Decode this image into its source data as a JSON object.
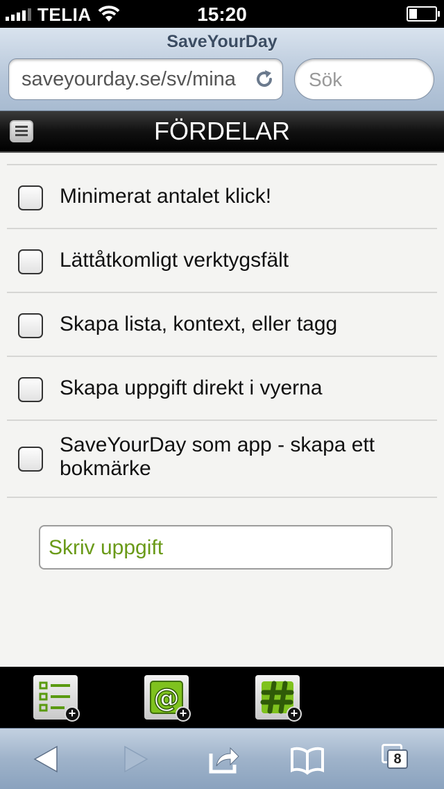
{
  "status_bar": {
    "carrier": "TELIA",
    "time": "15:20",
    "signal_bars": 4,
    "signal_bars_total": 5,
    "battery_level": 0.3
  },
  "browser": {
    "page_title": "SaveYourDay",
    "url": "saveyourday.se/sv/mina",
    "search_placeholder": "Sök"
  },
  "app_header": {
    "title": "FÖRDELAR",
    "menu_icon": "menu-icon"
  },
  "tasks": [
    {
      "label": "Minimerat antalet klick!",
      "checked": false
    },
    {
      "label": "Lättåtkomligt verktygsfält",
      "checked": false
    },
    {
      "label": "Skapa lista, kontext, eller tagg",
      "checked": false
    },
    {
      "label": "Skapa uppgift direkt i vyerna",
      "checked": false
    },
    {
      "label": "SaveYourDay som app - skapa ett bokmärke",
      "checked": false
    }
  ],
  "new_task": {
    "placeholder": "Skriv uppgift"
  },
  "app_toolbar": [
    {
      "icon": "add-list-icon"
    },
    {
      "icon": "add-context-icon"
    },
    {
      "icon": "add-tag-icon"
    }
  ],
  "browser_toolbar": {
    "tab_count": "8"
  },
  "colors": {
    "placeholder_green": "#6a9a18",
    "icon_green": "#7fc21e",
    "safari_blue": "#9fb3ca"
  }
}
